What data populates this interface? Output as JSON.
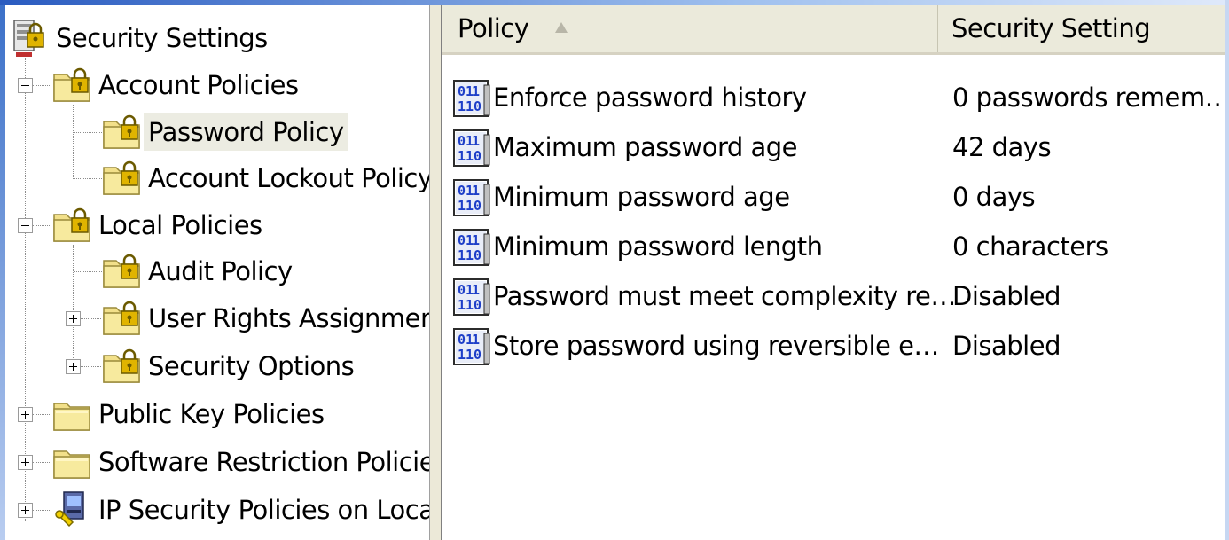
{
  "tree": {
    "items": [
      {
        "label": "Security Settings",
        "icon": "security-settings-icon"
      },
      {
        "label": "Account Policies",
        "icon": "policy-folder-icon",
        "expanded": true
      },
      {
        "label": "Password Policy",
        "icon": "policy-folder-icon",
        "selected": true
      },
      {
        "label": "Account Lockout Policy",
        "icon": "policy-folder-icon"
      },
      {
        "label": "Local Policies",
        "icon": "policy-folder-icon",
        "expanded": true
      },
      {
        "label": "Audit Policy",
        "icon": "policy-folder-icon"
      },
      {
        "label": "User Rights Assignmen",
        "icon": "policy-folder-icon",
        "expanded": false
      },
      {
        "label": "Security Options",
        "icon": "policy-folder-icon",
        "expanded": false
      },
      {
        "label": "Public Key Policies",
        "icon": "folder-icon",
        "expanded": false
      },
      {
        "label": "Software Restriction Policie",
        "icon": "folder-icon",
        "expanded": false
      },
      {
        "label": "IP Security Policies on Loca",
        "icon": "ip-security-icon",
        "expanded": false
      }
    ]
  },
  "list": {
    "columns": {
      "policy": "Policy",
      "setting": "Security Setting"
    },
    "sort": "ascending",
    "rows": [
      {
        "policy": "Enforce password history",
        "setting": "0 passwords remem…"
      },
      {
        "policy": "Maximum password age",
        "setting": "42 days"
      },
      {
        "policy": "Minimum password age",
        "setting": "0 days"
      },
      {
        "policy": "Minimum password length",
        "setting": "0 characters"
      },
      {
        "policy": "Password must meet complexity re…",
        "setting": "Disabled"
      },
      {
        "policy": "Store password using reversible e…",
        "setting": "Disabled"
      }
    ]
  },
  "colors": {
    "folder": "#f2e08a",
    "lock": "#c9a400",
    "policy_icon_blue": "#1e3fc8",
    "header_bg": "#ebeadb",
    "selection_bg": "#ecece2"
  }
}
